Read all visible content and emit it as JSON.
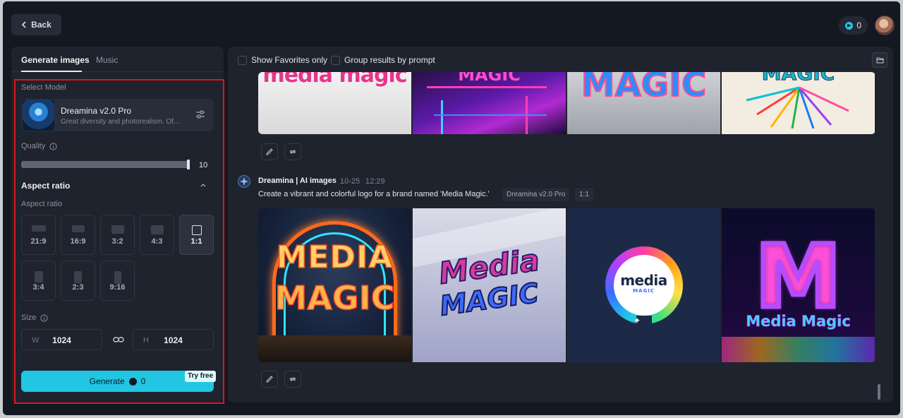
{
  "header": {
    "back_label": "Back",
    "credits": "0"
  },
  "tabs": [
    {
      "label": "Generate images"
    },
    {
      "label": "Music"
    }
  ],
  "model": {
    "section_label": "Select Model",
    "name": "Dreamina v2.0 Pro",
    "description": "Great diversity and photorealism. Of..."
  },
  "quality": {
    "label": "Quality",
    "value": "10",
    "level_fraction": 1.0
  },
  "aspect": {
    "header": "Aspect ratio",
    "label": "Aspect ratio",
    "options": [
      "21:9",
      "16:9",
      "3:2",
      "4:3",
      "1:1",
      "3:4",
      "2:3",
      "9:16"
    ],
    "selected": "1:1"
  },
  "size": {
    "label": "Size",
    "w_prefix": "W",
    "w_value": "1024",
    "h_prefix": "H",
    "h_value": "1024"
  },
  "generate": {
    "label": "Generate",
    "credits": "0",
    "badge": "Try free"
  },
  "filters": {
    "favorites": "Show Favorites only",
    "group": "Group results by prompt"
  },
  "result_top": {
    "tiles": [
      "media magic",
      "MAGIC",
      "MAGIC",
      "MAGIC"
    ]
  },
  "result": {
    "author": "Dreamina | AI images",
    "date": "10-25",
    "time": "12:29",
    "prompt": "Create a vibrant and colorful logo for a brand named 'Media Magic.'",
    "model_tag": "Dreamina v2.0 Pro",
    "ratio_tag": "1:1",
    "tiles": [
      {
        "line1": "MEDIA",
        "line2": "MAGIC"
      },
      {
        "line1": "Media",
        "line2": "MAGIC"
      },
      {
        "line1": "media",
        "line2": "MAGIC"
      },
      {
        "line1": "M",
        "line2": "Media Magic"
      }
    ]
  },
  "colors": {
    "accent": "#22c6e3",
    "highlight": "#e0161c",
    "panel": "#1e232d",
    "app": "#141821"
  }
}
